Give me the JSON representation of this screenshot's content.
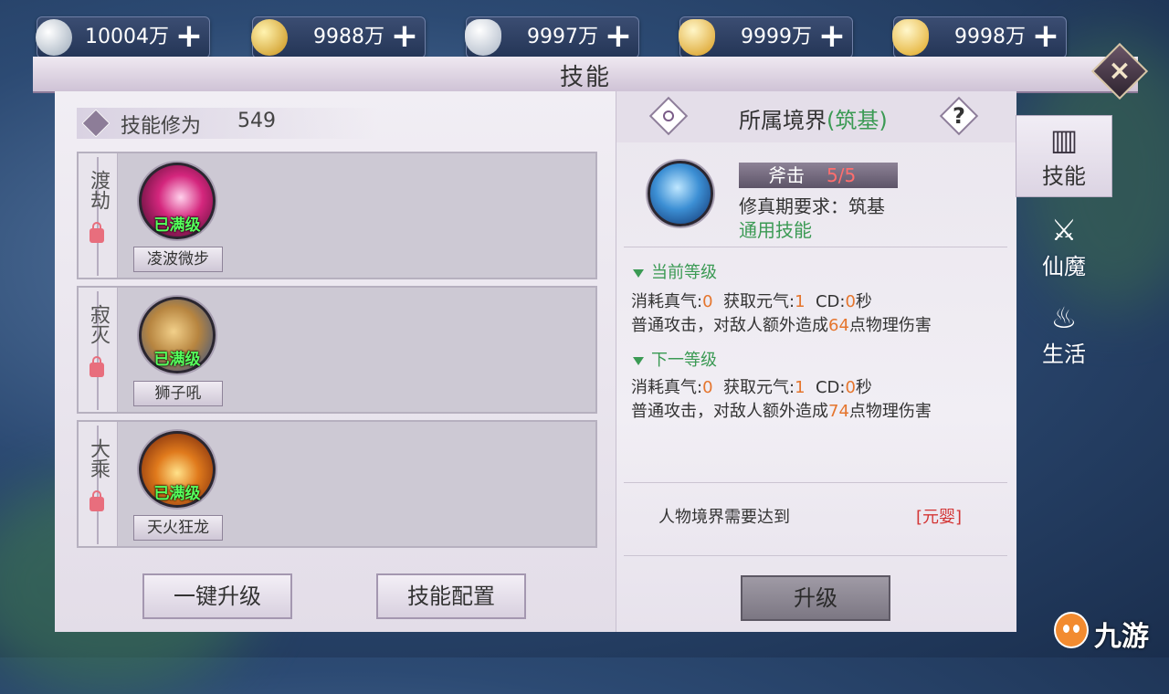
{
  "currencies": [
    {
      "icon": "silver-coin-icon",
      "value": "10004万",
      "color": "#c9d3df"
    },
    {
      "icon": "gold-coin-icon",
      "value": "9988万",
      "color": "#e5b63b"
    },
    {
      "icon": "silver-ingot-icon",
      "value": "9997万",
      "color": "#d8dde6"
    },
    {
      "icon": "gold-ingot-icon",
      "value": "9999万",
      "color": "#f0c04a"
    },
    {
      "icon": "gold-ingot-alt-icon",
      "value": "9998万",
      "color": "#f2c445"
    }
  ],
  "window": {
    "title": "技能",
    "close_icon": "close-icon"
  },
  "cultivation": {
    "label": "技能修为",
    "value": "549"
  },
  "skills": [
    {
      "tier": "渡劫",
      "name": "凌波微步",
      "status": "已满级",
      "icon_color": "#d4267d"
    },
    {
      "tier": "寂灭",
      "name": "狮子吼",
      "status": "已满级",
      "icon_color": "#b78540"
    },
    {
      "tier": "大乘",
      "name": "天火狂龙",
      "status": "已满级",
      "icon_color": "#d9551c"
    }
  ],
  "buttons": {
    "one_click": "一键升级",
    "config": "技能配置",
    "upgrade": "升级"
  },
  "detail": {
    "realm_title": "所属境界",
    "realm_sub": "(筑基)",
    "help": "?",
    "skill_name": "斧击",
    "skill_level": "5/5",
    "requirement": "修真期要求：筑基",
    "type": "通用技能",
    "current": {
      "heading": "当前等级",
      "cost_prefix": "消耗真气:",
      "cost": "0",
      "gain_prefix": "获取元气:",
      "gain": "1",
      "cd_prefix": "CD:",
      "cd": "0",
      "cd_unit": "秒",
      "desc_prefix": "普通攻击，对敌人额外造成",
      "damage": "64",
      "desc_suffix": "点物理伤害"
    },
    "next": {
      "heading": "下一等级",
      "cost_prefix": "消耗真气:",
      "cost": "0",
      "gain_prefix": "获取元气:",
      "gain": "1",
      "cd_prefix": "CD:",
      "cd": "0",
      "cd_unit": "秒",
      "desc_prefix": "普通攻击，对敌人额外造成",
      "damage": "74",
      "desc_suffix": "点物理伤害"
    },
    "need_label": "人物境界需要达到",
    "need_value": "[元婴]"
  },
  "side_tabs": [
    {
      "icon": "skill-book-icon",
      "label": "技能",
      "active": true
    },
    {
      "icon": "sword-icon",
      "label": "仙魔",
      "active": false
    },
    {
      "icon": "cooking-pot-icon",
      "label": "生活",
      "active": false
    }
  ],
  "logo": {
    "text": "九游"
  }
}
